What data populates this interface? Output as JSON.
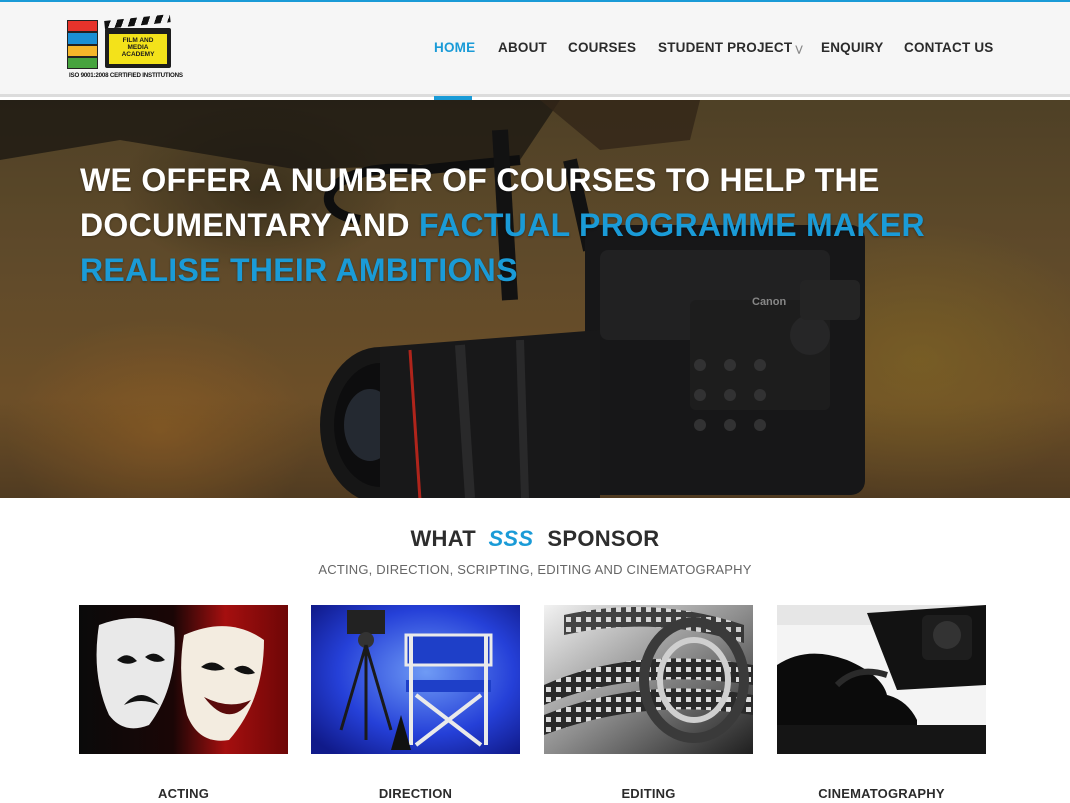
{
  "brand": {
    "logo_name": "FILM AND MEDIA ACADEMY",
    "logo_line1": "FILM AND",
    "logo_line2": "MEDIA",
    "logo_line3": "ACADEMY",
    "certification": "ISO 9001:2008 CERTIFIED INSTITUTIONS",
    "strip_colors": [
      "#e7332b",
      "#1b8fd4",
      "#f5b62a",
      "#46a33e"
    ]
  },
  "nav": {
    "items": [
      {
        "label": "HOME",
        "active": true
      },
      {
        "label": "ABOUT",
        "active": false
      },
      {
        "label": "COURSES",
        "active": false
      },
      {
        "label": "STUDENT PROJECT",
        "active": false,
        "has_dropdown": true,
        "dropdown_icon": "chevron-down-double-icon"
      },
      {
        "label": "ENQUIRY",
        "active": false
      },
      {
        "label": "CONTACT US",
        "active": false
      }
    ]
  },
  "hero": {
    "title_part1": "WE OFFER A NUMBER OF COURSES TO HELP THE DOCUMENTARY AND ",
    "title_highlight": "FACTUAL PROGRAMME MAKER REALISE THEIR AMBITIONS",
    "camera_brand": "Canon",
    "image_subject": "cinema camera"
  },
  "section": {
    "title_prefix": "WHAT",
    "title_highlight": "SSS",
    "title_suffix": "SPONSOR",
    "subtitle": "ACTING, DIRECTION, SCRIPTING, EDITING AND CINEMATOGRAPHY"
  },
  "cards": [
    {
      "label": "ACTING",
      "image": "theatre-masks"
    },
    {
      "label": "DIRECTION",
      "image": "director-chair"
    },
    {
      "label": "EDITING",
      "image": "film-reel"
    },
    {
      "label": "CINEMATOGRAPHY",
      "image": "camera-operator"
    }
  ],
  "colors": {
    "accent": "#1a9bd7",
    "nav_text": "#2b2b2b",
    "header_bg": "#f6f6f6"
  }
}
